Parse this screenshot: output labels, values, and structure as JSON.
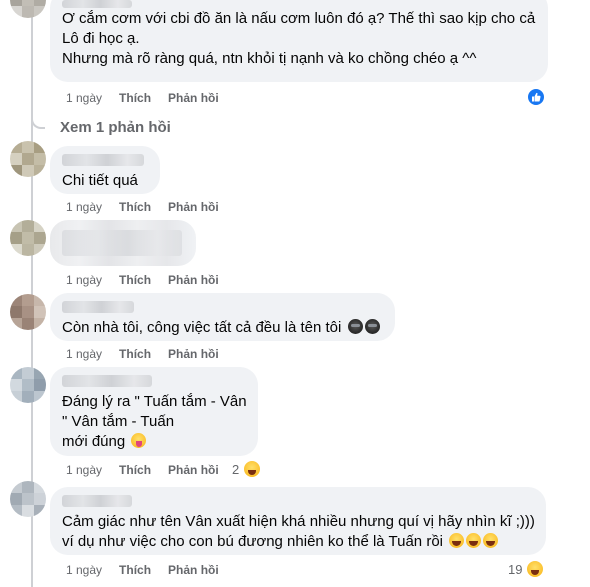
{
  "labels": {
    "like": "Thích",
    "reply": "Phản hồi"
  },
  "comments": [
    {
      "lines": [
        "Ơ cắm cơm với cbi đồ ăn là nấu cơm luôn đó ạ? Thế thì sao kịp cho cả",
        "Lô đi học ạ.",
        "Nhưng mà rõ ràng quá, ntn khỏi tị nạnh và ko chồng chéo ạ ^^"
      ],
      "time": "1 ngày",
      "reaction_icon": "like-icon"
    },
    {
      "lines": [
        "Chi tiết quá"
      ],
      "time": "1 ngày"
    },
    {
      "lines": [],
      "time": "1 ngày"
    },
    {
      "lines": [
        "Còn nhà tôi, công việc tất cả đều là tên tôi"
      ],
      "time": "1 ngày",
      "emoji_icons": [
        "dark-face-icon",
        "dark-face-icon"
      ]
    },
    {
      "lines": [
        "Đáng lý ra \" Tuấn tắm - Vân",
        "\" Vân tắm - Tuấn",
        "mới đúng"
      ],
      "time": "1 ngày",
      "emoji_icons": [
        "tongue-face-icon"
      ],
      "reaction_count": "2",
      "reaction_icon": "haha-icon"
    },
    {
      "lines": [
        "Cảm giác như tên Vân xuất hiện khá nhiều nhưng quí vị hãy nhìn kĩ ;)))",
        "ví dụ như việc cho con bú đương nhiên ko thể là Tuấn rồi"
      ],
      "time": "1 ngày",
      "emoji_icons": [
        "laugh-face-icon",
        "laugh-face-icon",
        "laugh-face-icon"
      ],
      "reaction_count": "19",
      "reaction_icon": "haha-icon"
    }
  ],
  "view_replies": "Xem 1 phản hồi"
}
